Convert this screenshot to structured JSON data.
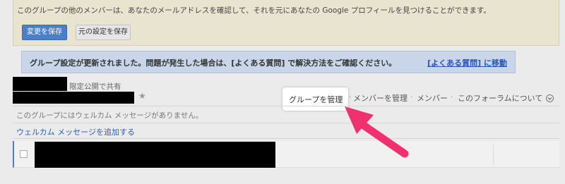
{
  "settings_notice": {
    "text": "このグループの他のメンバーは、あなたのメールアドレスを確認して、それを元にあなたの Google プロフィールを見つけることができます。",
    "save_button": "変更を保存",
    "restore_button": "元の設定を保存"
  },
  "banner": {
    "message": "グループ設定が更新されました。問題が発生した場合は、[よくある質問] で解決方法をご確認ください。",
    "link": "[よくある質問] に移動"
  },
  "group": {
    "sharing": "限定公開で共有",
    "star_icon": "star-icon"
  },
  "nav": {
    "manage_group": "グループを管理",
    "manage_members": "メンバーを管理",
    "members": "メンバー",
    "about_forum": "このフォーラムについて",
    "separator": "·",
    "menu_icon": "chevron-down-circle-icon"
  },
  "welcome": {
    "empty_message": "このグループにはウェルカム メッセージがありません。",
    "add_link": "ウェルカム メッセージを追加する"
  },
  "annotation": {
    "arrow_color": "#f0306f",
    "highlight_color": "#ffffff"
  }
}
